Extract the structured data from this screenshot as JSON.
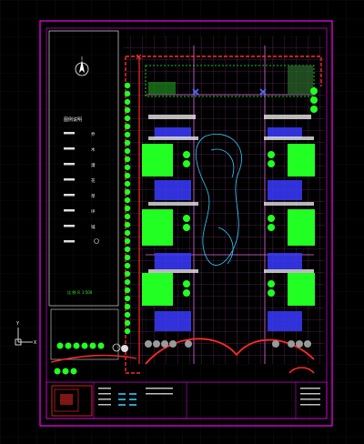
{
  "window": {
    "background": "#000000"
  },
  "colors": {
    "sheet_frame": "#ff00ff",
    "site_boundary": "#ff2a2a",
    "planting": "#22ff22",
    "paving": "#3a3aff",
    "grid": "#ff66ff",
    "water": "#33ccff",
    "white": "#ffffff"
  },
  "north_arrow": {
    "icon": "north-arrow-icon"
  },
  "legend": {
    "title": "图例说明",
    "items": [
      "乔",
      "木",
      "灌",
      "花",
      "草",
      "坪",
      "铺"
    ],
    "footnote": "比 例 尺 1:500"
  },
  "ucs": {
    "y_label": "Y",
    "x_label": "X"
  }
}
